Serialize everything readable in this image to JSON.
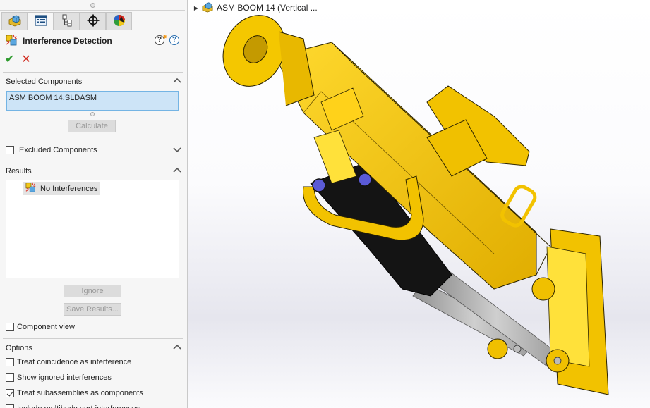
{
  "panel": {
    "tabs": [
      {
        "name": "feature-manager",
        "icon": "assembly-icon",
        "active": false
      },
      {
        "name": "property-manager",
        "icon": "property-manager-icon",
        "active": true
      },
      {
        "name": "configuration-manager",
        "icon": "configuration-icon",
        "active": false
      },
      {
        "name": "dimxpert-manager",
        "icon": "crosshair-icon",
        "active": false
      },
      {
        "name": "display-manager",
        "icon": "appearance-icon",
        "active": false
      }
    ],
    "title": "Interference Detection",
    "title_icon": "interference-detection-icon",
    "help_icons": [
      "whats-new-help-icon",
      "help-icon"
    ],
    "help_glyph": "?",
    "ok_glyph": "✔",
    "cancel_glyph": "✕",
    "selected_components": {
      "label": "Selected Components",
      "items": [
        "ASM BOOM 14.SLDASM"
      ],
      "calculate_label": "Calculate"
    },
    "excluded_components": {
      "label": "Excluded Components",
      "checked": false
    },
    "results": {
      "label": "Results",
      "items": [
        "No Interferences"
      ],
      "ignore_label": "Ignore",
      "save_results_label": "Save Results...",
      "component_view_label": "Component view",
      "component_view_checked": false
    },
    "options": {
      "label": "Options",
      "items": [
        {
          "label": "Treat coincidence as interference",
          "checked": false
        },
        {
          "label": "Show ignored interferences",
          "checked": false
        },
        {
          "label": "Treat subassemblies as components",
          "checked": true
        },
        {
          "label": "Include multibody part interferences",
          "checked": false
        }
      ]
    }
  },
  "viewport": {
    "tree_root_label": "ASM BOOM 14  (Vertical ...",
    "tree_root_icon": "assembly-icon",
    "expander_glyph": "▶",
    "model_colors": {
      "body": "#f2c200",
      "body_shade": "#d9a800",
      "body_light": "#ffd92e",
      "cylinder": "#141414",
      "rod": "#b9b9b9",
      "pin": "#5a5ad6",
      "edge": "#2a2200"
    }
  }
}
